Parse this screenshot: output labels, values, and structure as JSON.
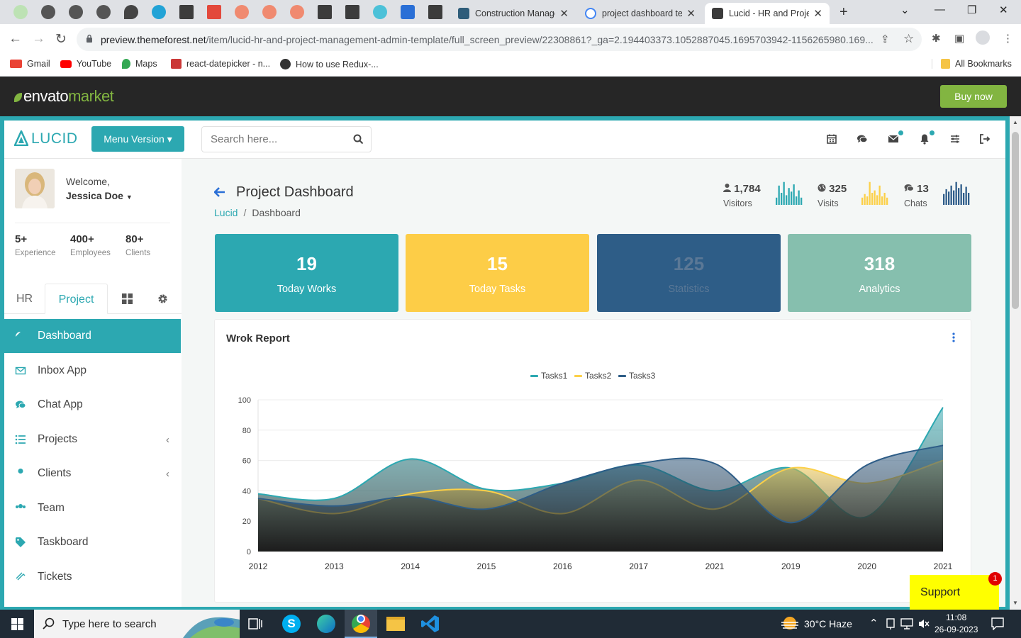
{
  "browser": {
    "tabs": [
      {
        "title": "Construction Manage",
        "fav": "#2f5d7a"
      },
      {
        "title": "project dashboard te",
        "fav": "#4285f4"
      },
      {
        "title": "Lucid - HR and Projec",
        "fav": "#3b3b3b"
      }
    ],
    "url_host": "preview.themeforest.net",
    "url_path": "/item/lucid-hr-and-project-management-admin-template/full_screen_preview/22308861?_ga=2.194403373.1052887045.1695703942-1156265980.169...",
    "bookmarks": [
      "Gmail",
      "YouTube",
      "Maps",
      "react-datepicker - n...",
      "How to use Redux-..."
    ],
    "all_bookmarks": "All Bookmarks"
  },
  "envato": {
    "logo_a": "envato",
    "logo_b": "market",
    "buy_label": "Buy now"
  },
  "app": {
    "logo": "LUCID",
    "menu_version": "Menu Version",
    "search_placeholder": "Search here...",
    "user": {
      "welcome": "Welcome,",
      "name": "Jessica Doe"
    },
    "stats": [
      {
        "value": "5+",
        "label": "Experience"
      },
      {
        "value": "400+",
        "label": "Employees"
      },
      {
        "value": "80+",
        "label": "Clients"
      }
    ],
    "sidebar_tabs": [
      "HR",
      "Project"
    ],
    "menu": [
      {
        "label": "Dashboard",
        "icon": "dashboard-icon",
        "active": true
      },
      {
        "label": "Inbox App",
        "icon": "envelope-icon"
      },
      {
        "label": "Chat App",
        "icon": "chat-icon"
      },
      {
        "label": "Projects",
        "icon": "list-icon",
        "chevron": true
      },
      {
        "label": "Clients",
        "icon": "user-icon",
        "chevron": true
      },
      {
        "label": "Team",
        "icon": "users-icon"
      },
      {
        "label": "Taskboard",
        "icon": "tag-icon"
      },
      {
        "label": "Tickets",
        "icon": "ticket-icon"
      }
    ],
    "page_title": "Project Dashboard",
    "breadcrumb": [
      "Lucid",
      "Dashboard"
    ],
    "mini_stats": [
      {
        "value": "1,784",
        "label": "Visitors",
        "icon": "user-icon",
        "color": "#2ca8b1"
      },
      {
        "value": "325",
        "label": "Visits",
        "icon": "globe-icon",
        "color": "#fcd048"
      },
      {
        "value": "13",
        "label": "Chats",
        "icon": "comments-icon",
        "color": "#2f5d8a"
      }
    ],
    "cards": [
      {
        "value": "19",
        "label": "Today Works",
        "color": "#2ca8b1"
      },
      {
        "value": "15",
        "label": "Today Tasks",
        "color": "#fdcd47"
      },
      {
        "value": "125",
        "label": "Statistics",
        "color": "#2e5d87"
      },
      {
        "value": "318",
        "label": "Analytics",
        "color": "#86bfae"
      }
    ],
    "panel_title": "Wrok Report",
    "support": "Support",
    "support_badge": "1"
  },
  "chart_data": {
    "type": "area",
    "title": "Wrok Report",
    "categories": [
      "2012",
      "2013",
      "2014",
      "2015",
      "2016",
      "2017",
      "2021",
      "2019",
      "2020",
      "2021"
    ],
    "ylim": [
      0,
      100
    ],
    "yticks": [
      "0",
      "20",
      "40",
      "60",
      "80",
      "100"
    ],
    "legend": "top-center",
    "grid": true,
    "series": [
      {
        "name": "Tasks1",
        "color": "#2ca8b1",
        "values": [
          38,
          35,
          61,
          41,
          45,
          57,
          40,
          55,
          23,
          95
        ]
      },
      {
        "name": "Tasks2",
        "color": "#fcd048",
        "values": [
          35,
          25,
          38,
          40,
          25,
          47,
          28,
          55,
          45,
          60
        ]
      },
      {
        "name": "Tasks3",
        "color": "#2e5d87",
        "values": [
          35,
          30,
          36,
          28,
          45,
          58,
          58,
          19,
          57,
          70
        ]
      }
    ]
  },
  "taskbar": {
    "search_placeholder": "Type here to search",
    "weather": "30°C  Haze",
    "time": "11:08",
    "date": "26-09-2023"
  }
}
